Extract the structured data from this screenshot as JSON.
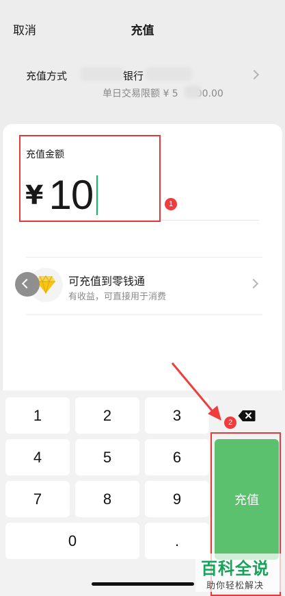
{
  "nav": {
    "cancel_label": "取消",
    "title": "充值"
  },
  "payment_method": {
    "label": "充值方式",
    "bank_suffix": "银行",
    "limit_prefix": "单日交易限额 ¥ 5",
    "limit_suffix": "00.00"
  },
  "amount": {
    "label": "充值金额",
    "currency": "¥",
    "value": "10"
  },
  "lingqiantong": {
    "title": "可充值到零钱通",
    "subtitle": "有收益，可直接用于消费"
  },
  "keypad": {
    "keys": [
      "1",
      "2",
      "3",
      "4",
      "5",
      "6",
      "7",
      "8",
      "9",
      "0",
      "."
    ],
    "confirm_label": "充值"
  },
  "annotations": {
    "badge_1": "1",
    "badge_2": "2"
  },
  "watermark": {
    "main": "百科全说",
    "sub": "助你轻松解决"
  },
  "colors": {
    "accent_green": "#07c160",
    "confirm_button": "#5bc16e",
    "annotation_red": "#e23a3a"
  }
}
